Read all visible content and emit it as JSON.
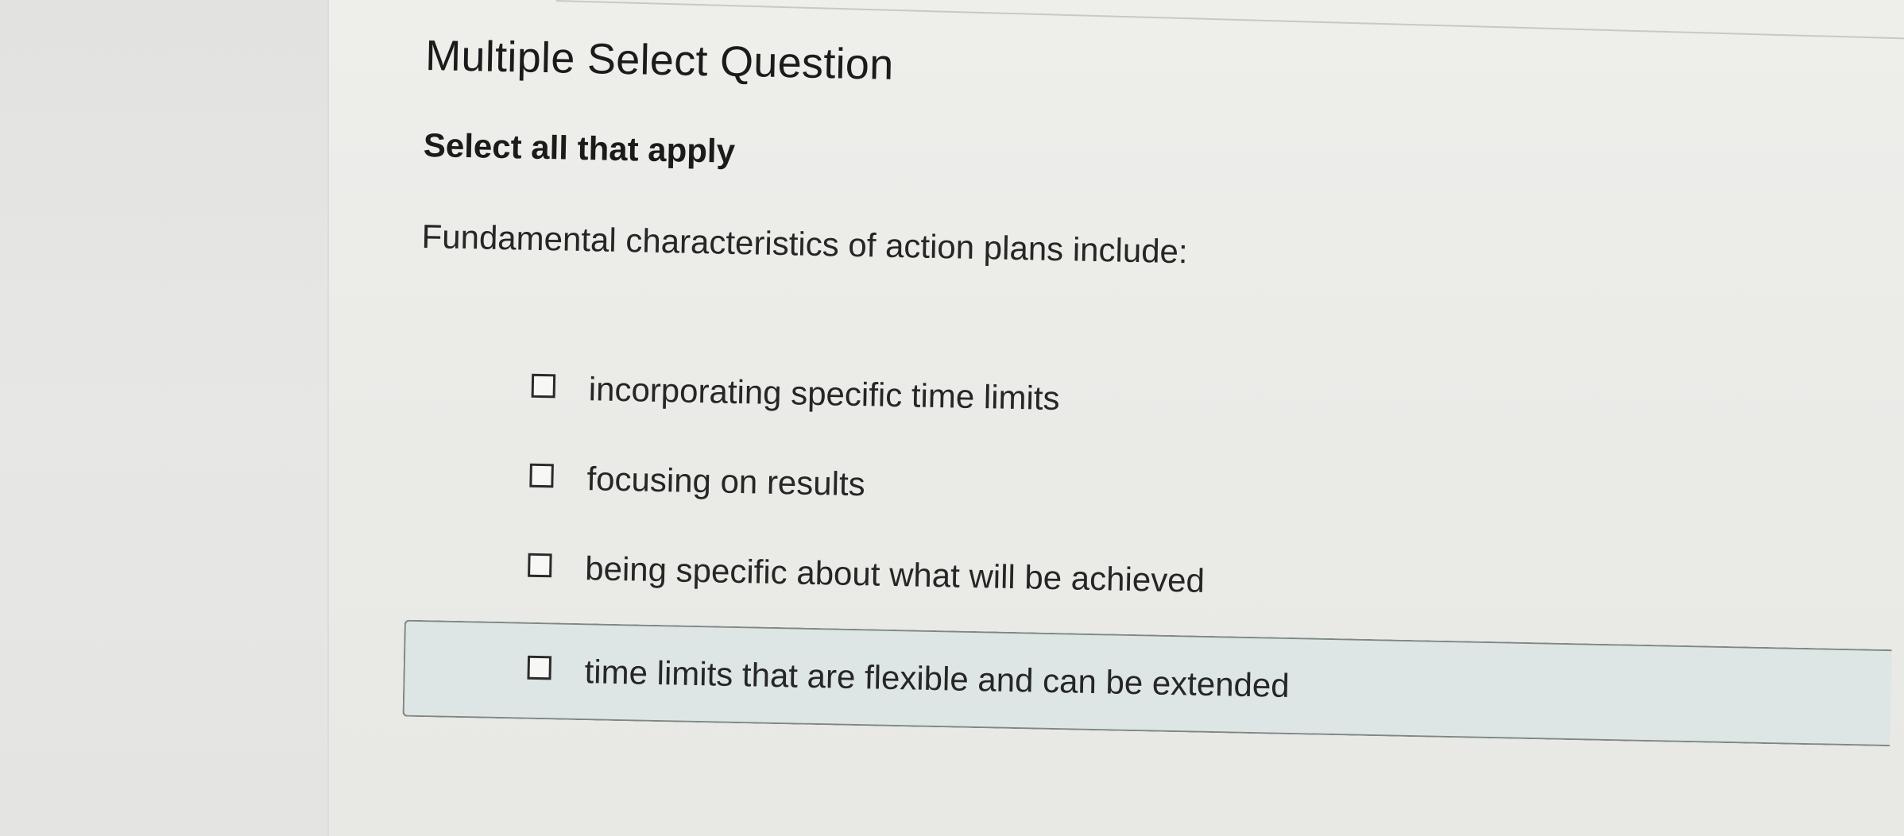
{
  "question": {
    "title": "Multiple Select Question",
    "instruction": "Select all that apply",
    "prompt": "Fundamental characteristics of action plans include:",
    "options": [
      {
        "label": "incorporating specific time limits",
        "checked": false
      },
      {
        "label": "focusing on results",
        "checked": false
      },
      {
        "label": "being specific about what will be achieved",
        "checked": false
      },
      {
        "label": "time limits that are flexible and can be extended",
        "checked": false,
        "highlighted": true
      }
    ]
  },
  "colors": {
    "highlight_bg": "#dde6e5",
    "highlight_border": "#7d8785",
    "text": "#262626"
  }
}
